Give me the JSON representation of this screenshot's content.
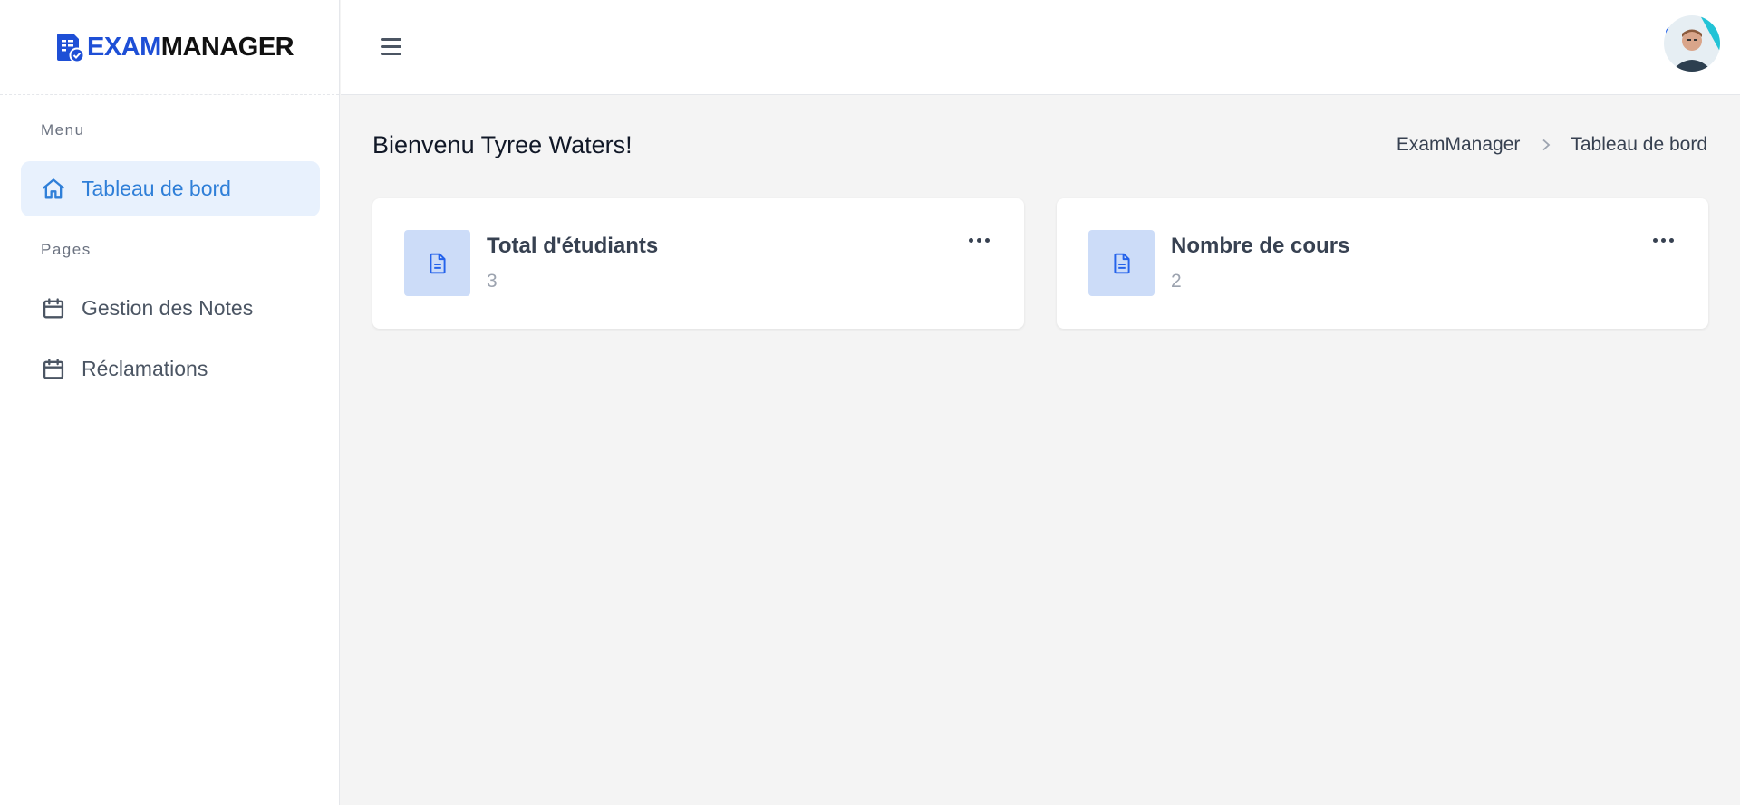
{
  "brand": {
    "part1": "EXAM",
    "part2": "MANAGER"
  },
  "sidebar": {
    "menu_label": "Menu",
    "pages_label": "Pages",
    "items": [
      {
        "label": "Tableau de bord",
        "icon": "home-icon"
      },
      {
        "label": "Gestion des Notes",
        "icon": "calendar-icon"
      },
      {
        "label": "Réclamations",
        "icon": "calendar-icon"
      }
    ]
  },
  "header": {
    "greeting": "Bienvenu Tyree Waters!"
  },
  "breadcrumb": {
    "root": "ExamManager",
    "current": "Tableau de bord"
  },
  "cards": [
    {
      "title": "Total d'étudiants",
      "value": "3",
      "icon": "document-icon"
    },
    {
      "title": "Nombre de cours",
      "value": "2",
      "icon": "document-icon"
    }
  ],
  "colors": {
    "accent": "#1e4fd6",
    "active_bg": "#e8f1fd",
    "active_text": "#2f7fd8",
    "card_icon_bg": "#ccdcf8"
  }
}
